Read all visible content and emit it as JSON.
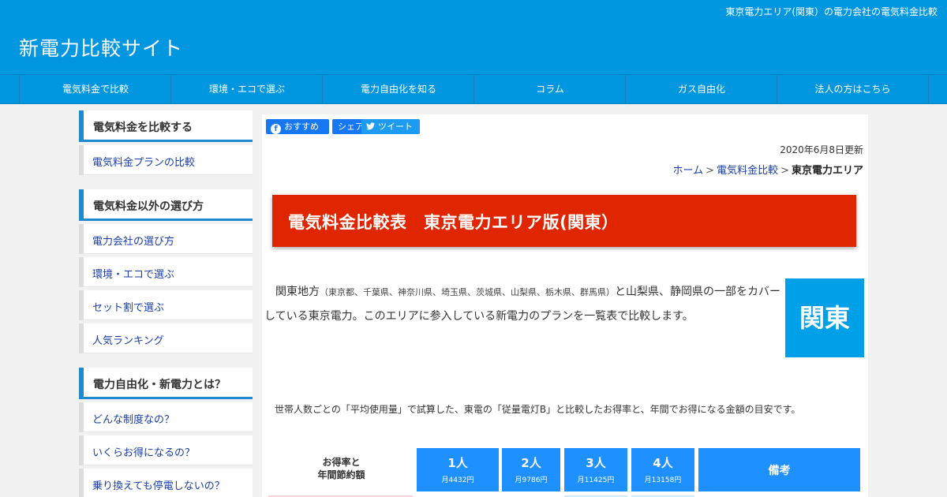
{
  "header": {
    "tagline": "東京電力エリア(関東）の電力会社の電気料金比較",
    "site_title": "新電力比較サイト"
  },
  "nav": {
    "items": [
      "電気料金で比較",
      "環境・エコで選ぶ",
      "電力自由化を知る",
      "コラム",
      "ガス自由化",
      "法人の方はこちら"
    ]
  },
  "sidebar": {
    "sections": [
      {
        "heading": "電気料金を比較する",
        "items": [
          "電気料金プランの比較"
        ]
      },
      {
        "heading": "電気料金以外の選び方",
        "items": [
          "電力会社の選び方",
          "環境・エコで選ぶ",
          "セット割で選ぶ",
          "人気ランキング"
        ]
      },
      {
        "heading": "電力自由化・新電力とは？",
        "items": [
          "どんな制度なの？",
          "いくらお得になるの？",
          "乗り換えても停電しないの？"
        ]
      }
    ]
  },
  "share": {
    "facebook_label": "おすすめ",
    "share_label": "シェア",
    "tweet_label": "ツイート"
  },
  "article": {
    "updated": "2020年6月8日更新",
    "breadcrumb": {
      "home": "ホーム",
      "parent": "電気料金比較",
      "current": "東京電力エリア"
    },
    "title": "電気料金比較表　東京電力エリア版(関東）",
    "intro_before": "関東地方",
    "intro_note": "（東京都、千葉県、神奈川県、埼玉県、茨城県、山梨県、栃木県、群馬県）",
    "intro_after": "と山梨県、静岡県の一部をカバーしている東京電力。このエリアに参入している新電力のプランを一覧表で比較します。",
    "area_badge": "関東",
    "calc_note": "世帯人数ごとの「平均使用量」で試算した、東電の「従量電灯B」と比較したお得率と、年間でお得になる金額の目安です。"
  },
  "comparison_table": {
    "row_label_line1": "お得率と",
    "row_label_line2": "年間節約額",
    "columns": [
      {
        "label": "1人",
        "sub": "月4432円"
      },
      {
        "label": "2人",
        "sub": "月9786円"
      },
      {
        "label": "3人",
        "sub": "月11425円"
      },
      {
        "label": "4人",
        "sub": "月13158円"
      },
      {
        "label": "備考",
        "sub": ""
      }
    ]
  },
  "colors": {
    "brand_blue": "#0096e0",
    "title_red": "#e02600",
    "badge_blue": "#00a0e9",
    "table_head_blue": "#1e90ff",
    "link_blue": "#1a3ea8"
  }
}
